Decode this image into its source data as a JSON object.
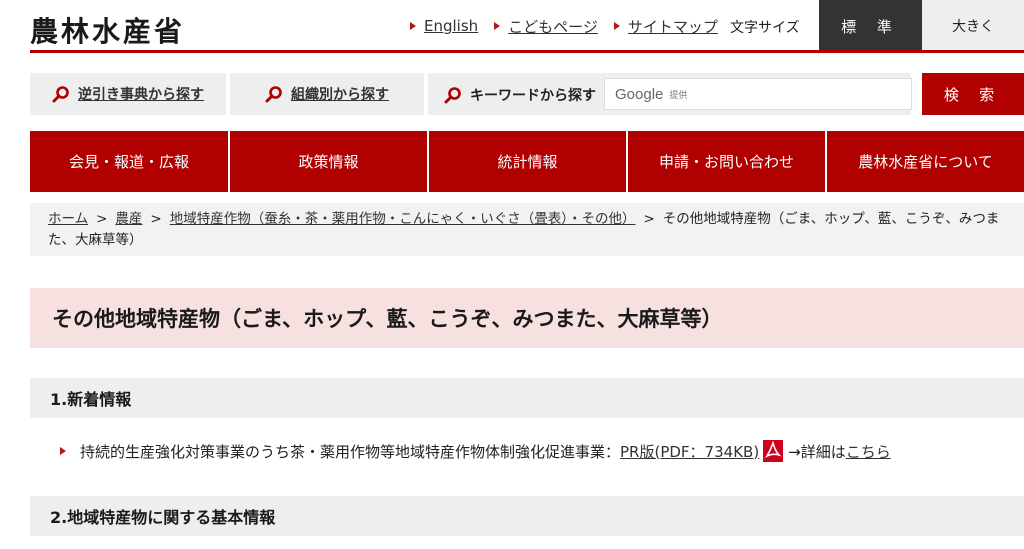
{
  "header": {
    "logo": "農林水産省",
    "links": [
      {
        "label": "English"
      },
      {
        "label": "こどもページ"
      },
      {
        "label": "サイトマップ"
      }
    ],
    "font_size_label": "文字サイズ",
    "font_standard": "標 準",
    "font_large": "大きく"
  },
  "search": {
    "reverse_dict": "逆引き事典から探す",
    "by_org": "組織別から探す",
    "keyword_label": "キーワードから探す",
    "google_word": "Google",
    "google_sub": "提供",
    "button": "検 索"
  },
  "gnav": [
    "会見・報道・広報",
    "政策情報",
    "統計情報",
    "申請・お問い合わせ",
    "農林水産省について"
  ],
  "breadcrumb": {
    "home": "ホーム",
    "agri": "農産",
    "regional": "地域特産作物（蚕糸・茶・薬用作物・こんにゃく・いぐさ（畳表）・その他）",
    "current": "その他地域特産物（ごま、ホップ、藍、こうぞ、みつまた、大麻草等）",
    "separator": ">"
  },
  "page_title": "その他地域特産物（ごま、ホップ、藍、こうぞ、みつまた、大麻草等）",
  "section1": {
    "heading": "1.新着情報",
    "item_text": "持続的生産強化対策事業のうち茶・薬用作物等地域特産作物体制強化促進事業：",
    "item_link": "PR版(PDF：734KB)",
    "item_after": "→詳細は",
    "item_here": "こちら"
  },
  "section2": {
    "heading": "2.地域特産物に関する基本情報"
  },
  "colors": {
    "brand_red": "#b00000",
    "title_bg": "#f7e1e0",
    "section_bg": "#eeeeee"
  }
}
